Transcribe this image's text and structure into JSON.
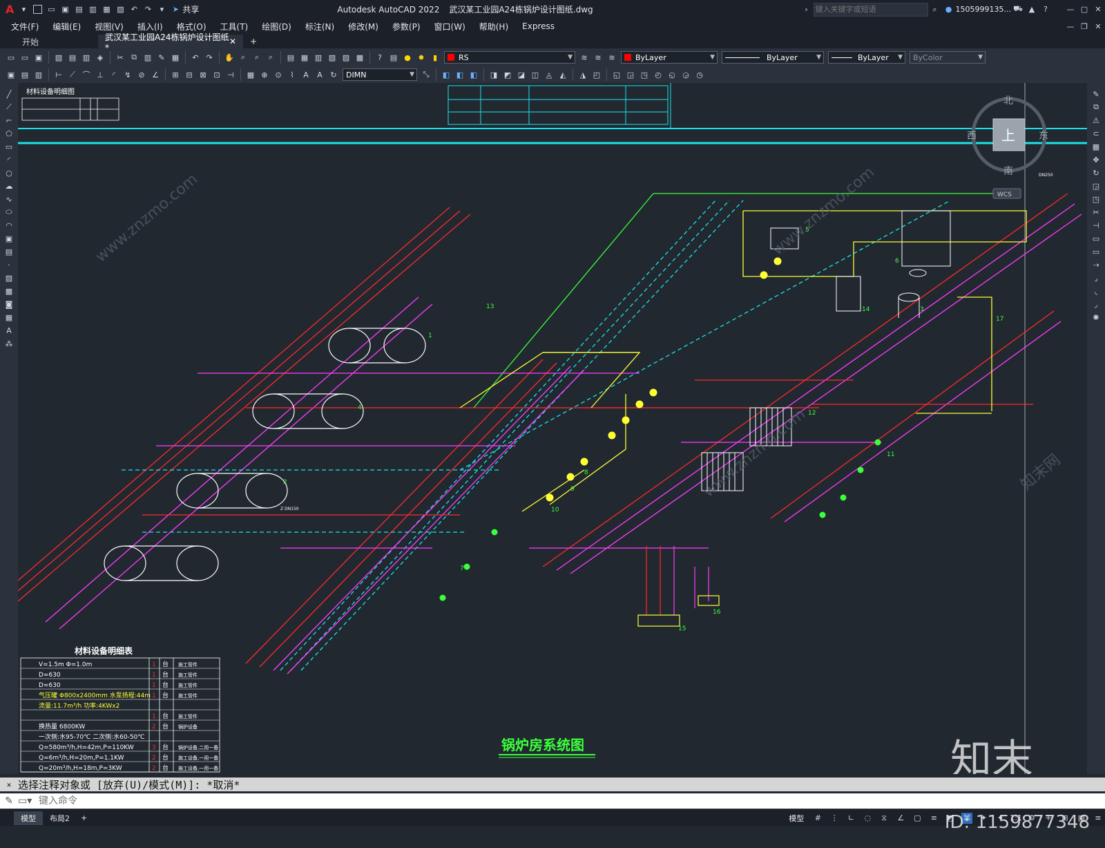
{
  "titlebar": {
    "app_title": "Autodesk AutoCAD 2022",
    "file_name": "武汉某工业园A24栋锅炉设计图纸.dwg",
    "share_label": "共享",
    "search_placeholder": "键入关键字或短语",
    "user": "1505999135..."
  },
  "menu": {
    "items": [
      "文件(F)",
      "编辑(E)",
      "视图(V)",
      "插入(I)",
      "格式(O)",
      "工具(T)",
      "绘图(D)",
      "标注(N)",
      "修改(M)",
      "参数(P)",
      "窗口(W)",
      "帮助(H)",
      "Express"
    ]
  },
  "tabs": {
    "start": "开始",
    "active": "武汉某工业园A24栋锅炉设计图纸*",
    "add": "+"
  },
  "properties": {
    "layer": "RS",
    "color": "ByLayer",
    "linetype": "ByLayer",
    "lineweight": "ByLayer",
    "plotstyle": "ByColor",
    "dimstyle": "DIMN"
  },
  "viewcube": {
    "north": "北",
    "south": "南",
    "east": "东",
    "west": "西",
    "top": "上",
    "wcs": "WCS"
  },
  "drawing": {
    "title": "锅炉房系统图",
    "table_title": "材料设备明细表",
    "table_rows": [
      {
        "spec": "V=1.5m   Φ=1.0m",
        "qty": "1",
        "unit": "台",
        "note": "施工管件"
      },
      {
        "spec": "D=630",
        "qty": "1",
        "unit": "台",
        "note": "施工管件"
      },
      {
        "spec": "D=630",
        "qty": "1",
        "unit": "台",
        "note": "施工管件"
      },
      {
        "spec": "气压罐 Φ800x2400mm   水泵扬程:44m",
        "qty": "1",
        "unit": "台",
        "note": "施工管件"
      },
      {
        "spec": "流量:11.7m³/h   功率:4KWx2",
        "qty": "",
        "unit": "",
        "note": ""
      },
      {
        "spec": "",
        "qty": "1",
        "unit": "台",
        "note": "施工管件"
      },
      {
        "spec": "换热量 6800KW",
        "qty": "2",
        "unit": "台",
        "note": "锅炉设备"
      },
      {
        "spec": "一次侧:水95-70℃ 二次侧:水60-50℃",
        "qty": "",
        "unit": "",
        "note": ""
      },
      {
        "spec": "Q=580m³/h,H=42m,P=110KW",
        "qty": "3",
        "unit": "台",
        "note": "锅炉设备,二用一备"
      },
      {
        "spec": "Q=6m³/h,H=20m,P=1.1KW",
        "qty": "2",
        "unit": "台",
        "note": "施工设备,一用一备"
      },
      {
        "spec": "Q=20m³/h,H=18m,P=3KW",
        "qty": "2",
        "unit": "台",
        "note": "施工设备,一用一备"
      }
    ],
    "table_top_label": "材料设备明细图",
    "labels": [
      "1",
      "2",
      "3",
      "4",
      "5",
      "6",
      "7",
      "8",
      "9",
      "10",
      "11",
      "12",
      "13",
      "14",
      "15",
      "16",
      "17",
      "Z DN150",
      "DN250"
    ]
  },
  "command": {
    "history": "选择注释对象或 [放弃(U)/模式(M)]: *取消*",
    "prompt_placeholder": "键入命令"
  },
  "status": {
    "model_tab": "模型",
    "layout_tab": "布局2",
    "add_tab": "+",
    "model_space": "模型",
    "scale": "1:1"
  },
  "watermark": {
    "brand": "知末",
    "id": "ID: 1159877348",
    "site": "www.znzmo.com",
    "cn_site": "知末网"
  },
  "colors": {
    "background": "#212830",
    "red": "#ff2a2a",
    "magenta": "#ff3dff",
    "green": "#3cff3c",
    "cyan": "#1ce3ea",
    "yellow": "#ffff33",
    "white": "#ffffff"
  }
}
